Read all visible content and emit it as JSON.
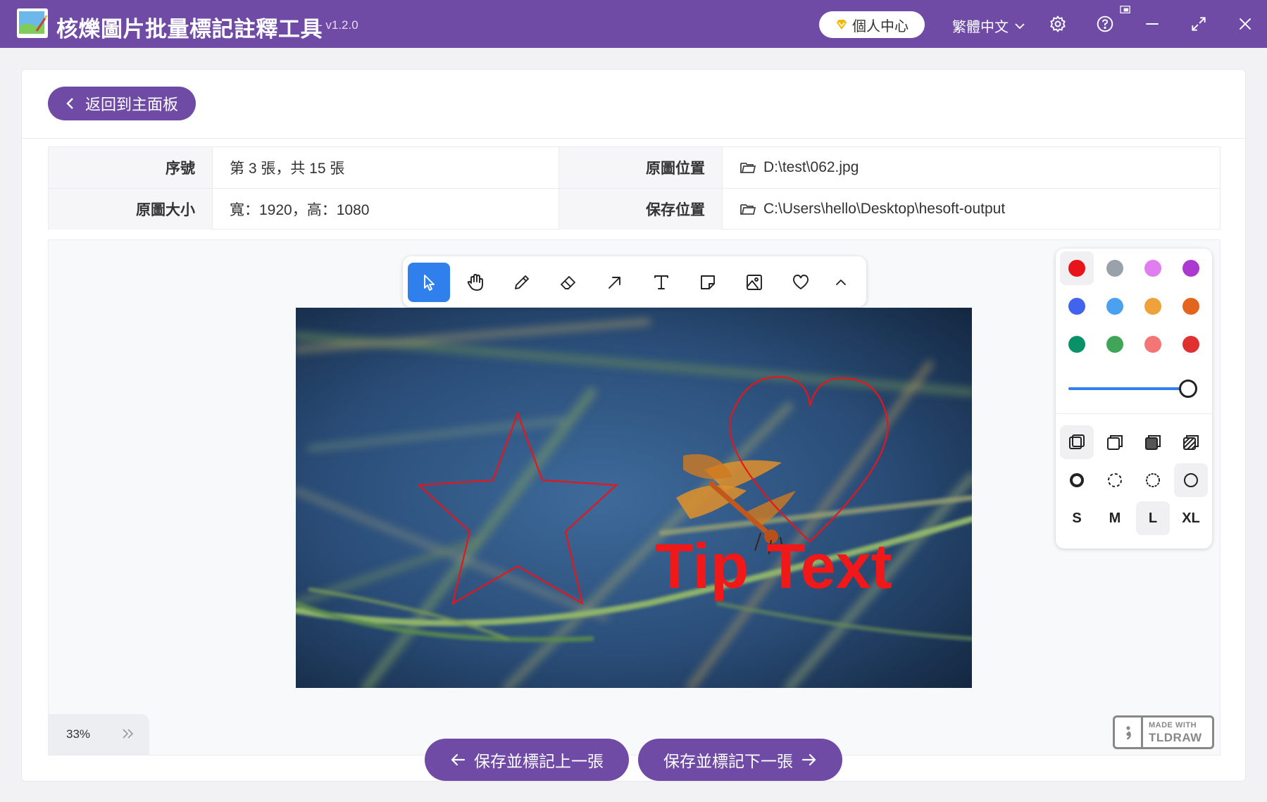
{
  "app": {
    "title": "核爍圖片批量標記註釋工具",
    "version": "- v1.2.0",
    "user_center": "個人中心",
    "language": "繁體中文"
  },
  "back_button": "返回到主面板",
  "info": {
    "index_label": "序號",
    "index_value": "第 3 張，共 15 張",
    "source_label": "原圖位置",
    "source_value": "D:\\test\\062.jpg",
    "size_label": "原圖大小",
    "size_value": "寬：1920，高：1080",
    "save_label": "保存位置",
    "save_value": "C:\\Users\\hello\\Desktop\\hesoft-output"
  },
  "tools": [
    "select-tool",
    "hand-tool",
    "draw-tool",
    "eraser-tool",
    "arrow-tool",
    "text-tool",
    "note-tool",
    "image-tool",
    "heart-tool",
    "more-tools"
  ],
  "annotation_text": "Tip Text",
  "colors": [
    "#e8141a",
    "#9ba1ab",
    "#e07ef0",
    "#ac3ad1",
    "#4263eb",
    "#4aa1f0",
    "#f0a23a",
    "#e3641c",
    "#099268",
    "#40a557",
    "#f37575",
    "#e03131"
  ],
  "size_options": [
    "S",
    "M",
    "L",
    "XL"
  ],
  "zoom": "33%",
  "branding": {
    "line1": "MADE WITH",
    "line2": "TLDRAW"
  },
  "prev_button": "保存並標記上一張",
  "next_button": "保存並標記下一張",
  "accent": "#6f4ba6"
}
